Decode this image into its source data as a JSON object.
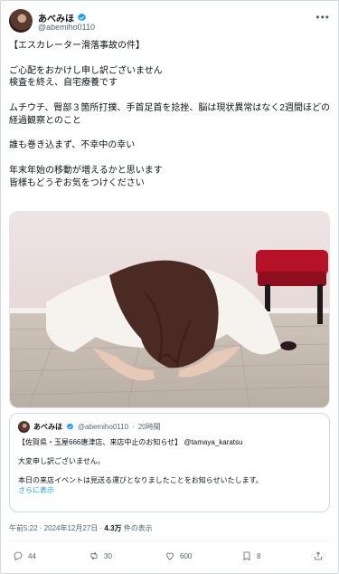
{
  "author": {
    "display_name": "あべみほ",
    "handle": "@abemiho0110"
  },
  "tweet": {
    "paragraphs": [
      "【エスカレーター滑落事故の件】",
      "ご心配をおかけし申し訳ございません\n検査を終え、自宅療養です",
      "ムチウチ、臀部３箇所打撲、手首足首を捻挫、脳は現状異常はなく2週間ほどの経過観察とのこと",
      "誰も巻き込まず、不幸中の幸い",
      "年末年始の移動が増えるかと思います\n皆様もどうぞお気をつけください"
    ]
  },
  "quote": {
    "display_name": "あべみほ",
    "handle": "@abemiho0110",
    "dot": "·",
    "time": "20時間",
    "line1": "【佐賀県・玉屋666唐津店、来店中止のお知らせ】 @tamaya_karatsu",
    "line2": "大変申し訳ございません。",
    "line3": "本日の来店イベントは見送る運びとなりましたことをお知らせいたします。",
    "show_more": "さらに表示"
  },
  "meta": {
    "time": "午前5:22 · 2024年12月27日 · ",
    "views_count": "4.3万",
    "views_label": " 件の表示"
  },
  "actions": {
    "replies": "44",
    "reposts": "30",
    "likes": "600",
    "bookmarks": "8"
  },
  "colors": {
    "accent": "#1d9bf0",
    "secondary_text": "#536471"
  }
}
